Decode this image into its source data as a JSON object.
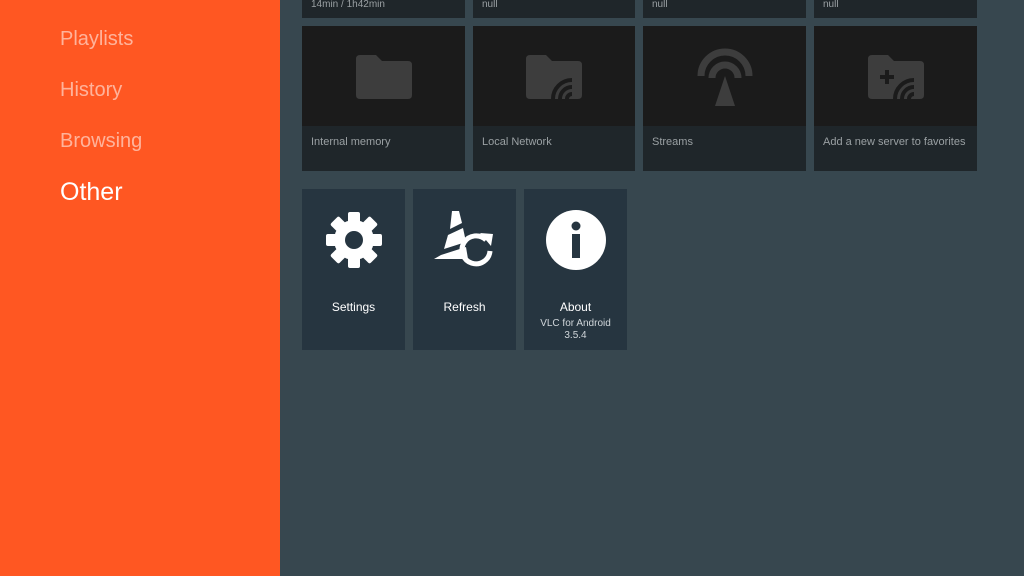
{
  "sidebar": {
    "items": [
      {
        "label": "Playlists"
      },
      {
        "label": "History"
      },
      {
        "label": "Browsing"
      },
      {
        "label": "Other"
      }
    ],
    "active_item": "Other",
    "background": "#ff5722"
  },
  "top_row": [
    {
      "subtitle": "14min / 1h42min"
    },
    {
      "subtitle": "null"
    },
    {
      "subtitle": "null"
    },
    {
      "subtitle": "null"
    }
  ],
  "browse_cards": [
    {
      "label": "Internal memory",
      "icon": "folder-icon"
    },
    {
      "label": "Local Network",
      "icon": "network-folder-icon"
    },
    {
      "label": "Streams",
      "icon": "antenna-icon"
    },
    {
      "label": "Add a new server to favorites",
      "icon": "add-server-folder-icon"
    }
  ],
  "other_tiles": [
    {
      "title": "Settings",
      "icon": "gear-icon"
    },
    {
      "title": "Refresh",
      "icon": "refresh-cone-icon"
    },
    {
      "title": "About",
      "subtitle_line1": "VLC for Android",
      "subtitle_line2": "3.5.4",
      "icon": "info-icon"
    }
  ],
  "colors": {
    "content_bg": "#37474f",
    "card_bg": "#1b1b1b",
    "tile_bg": "#263540"
  }
}
